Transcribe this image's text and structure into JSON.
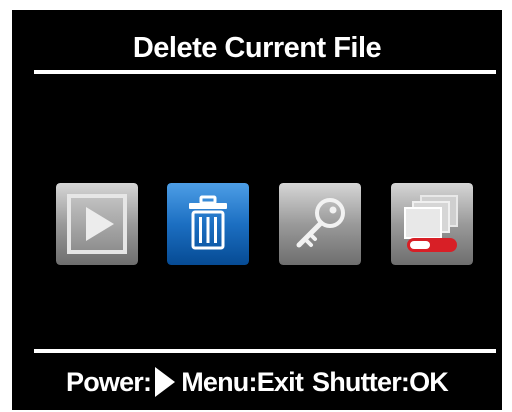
{
  "screen": {
    "title": "Delete Current File"
  },
  "icons": [
    {
      "name": "play-icon",
      "selected": false
    },
    {
      "name": "trash-icon",
      "selected": true
    },
    {
      "name": "key-icon",
      "selected": false
    },
    {
      "name": "slideshow-icon",
      "selected": false
    }
  ],
  "footer": {
    "power_label": "Power:",
    "power_icon": "right-arrow-icon",
    "menu_label": "Menu:",
    "menu_action": "Exit",
    "shutter_label": "Shutter:",
    "shutter_action": "OK"
  },
  "colors": {
    "background": "#000000",
    "text": "#ffffff",
    "selected_tile": "#0a5fb0",
    "unselected_tile": "#8a8a8a",
    "toggle_accent": "#d81f26"
  }
}
